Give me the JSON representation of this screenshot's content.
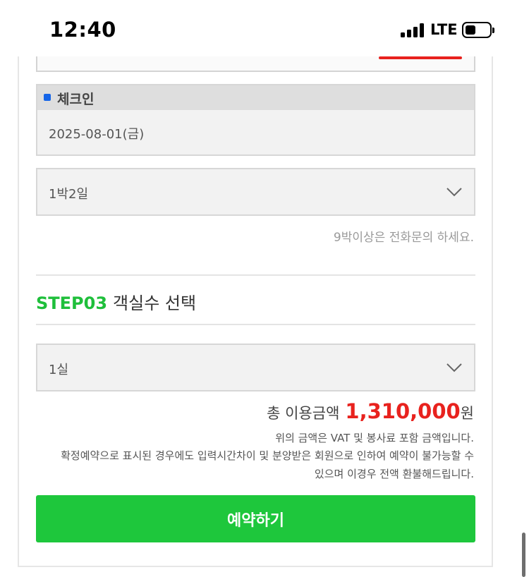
{
  "status_bar": {
    "time": "12:40",
    "network": "LTE",
    "battery_fraction": 0.4
  },
  "checkin": {
    "label": "체크인",
    "date": "2025-08-01(금)"
  },
  "nights": {
    "selected": "1박2일",
    "note": "9박이상은 전화문의 하세요."
  },
  "step3": {
    "step": "STEP03",
    "title": "객실수 선택"
  },
  "rooms": {
    "selected": "1실"
  },
  "total": {
    "label": "총 이용금액",
    "amount": "1,310,000",
    "unit": "원"
  },
  "notices": [
    "위의 금액은 VAT 및 봉사료 포함 금액입니다.",
    "확정예약으로 표시된 경우에도 입력시간차이 및 분양받은 회원으로 인하여 예약이 불가능할 수",
    "있으며 이경우 전액 환불해드립니다."
  ],
  "reserve_button": "예약하기",
  "colors": {
    "accent_green": "#1ec73c",
    "step_green": "#1fbf3b",
    "price_red": "#e8221e",
    "dot_blue": "#1565e8"
  }
}
